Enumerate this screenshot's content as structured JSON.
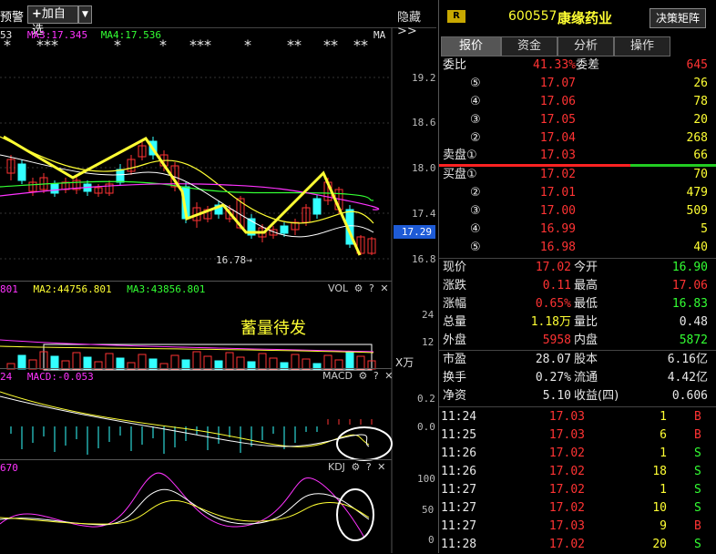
{
  "toolbar": {
    "warn_label": "预警",
    "add_watch_label": "加自选",
    "hide_label": "隐藏"
  },
  "kline": {
    "ma_labels": [
      "53",
      "MA3:17.345",
      "MA4:17.536"
    ],
    "ma_flag": "MA",
    "stars": [
      "*",
      "***",
      "*",
      "*",
      "***",
      "*",
      "**",
      "**",
      "**"
    ],
    "price_axis": [
      "19.2",
      "18.6",
      "18.0",
      "17.4",
      "16.8"
    ],
    "current_price_tag": "17.29",
    "low_label": "16.78"
  },
  "volume": {
    "ma_labels": [
      "801",
      "MA2:44756.801",
      "MA3:43856.801"
    ],
    "title": "VOL",
    "axis": [
      "24",
      "12"
    ],
    "unit": "X万",
    "annotation": "蓄量待发"
  },
  "macd": {
    "labels": [
      "24",
      "MACD:-0.053"
    ],
    "title": "MACD",
    "axis": [
      "0.2",
      "0.0"
    ]
  },
  "kdj": {
    "labels": [
      "670"
    ],
    "title": "KDJ",
    "axis": [
      "100",
      "50",
      "0"
    ]
  },
  "stock": {
    "badge": "R",
    "code": "600557",
    "name": "康缘药业",
    "decision_button": "决策矩阵"
  },
  "tabs": [
    "报价",
    "资金",
    "分析",
    "操作"
  ],
  "order_book": {
    "weibi_label": "委比",
    "weibi_value": "41.33%",
    "weicha_label": "委差",
    "weicha_value": "645",
    "asks": [
      {
        "level": "⑤",
        "price": "17.07",
        "vol": "26"
      },
      {
        "level": "④",
        "price": "17.06",
        "vol": "78"
      },
      {
        "level": "③",
        "price": "17.05",
        "vol": "20"
      },
      {
        "level": "②",
        "price": "17.04",
        "vol": "268"
      },
      {
        "level": "卖盘①",
        "price": "17.03",
        "vol": "66"
      }
    ],
    "bids": [
      {
        "level": "买盘①",
        "price": "17.02",
        "vol": "70"
      },
      {
        "level": "②",
        "price": "17.01",
        "vol": "479"
      },
      {
        "level": "③",
        "price": "17.00",
        "vol": "509"
      },
      {
        "level": "④",
        "price": "16.99",
        "vol": "5"
      },
      {
        "level": "⑤",
        "price": "16.98",
        "vol": "40"
      }
    ]
  },
  "quote": {
    "rows": [
      {
        "l1": "现价",
        "v1": "17.02",
        "l2": "今开",
        "v2": "16.90",
        "c1": "red",
        "c2": "green"
      },
      {
        "l1": "涨跌",
        "v1": "0.11",
        "l2": "最高",
        "v2": "17.06",
        "c1": "red",
        "c2": "red"
      },
      {
        "l1": "涨幅",
        "v1": "0.65%",
        "l2": "最低",
        "v2": "16.83",
        "c1": "red",
        "c2": "green"
      },
      {
        "l1": "总量",
        "v1": "1.18万",
        "l2": "量比",
        "v2": "0.48",
        "c1": "yellow",
        "c2": "white"
      },
      {
        "l1": "外盘",
        "v1": "5958",
        "l2": "内盘",
        "v2": "5872",
        "c1": "red",
        "c2": "green"
      }
    ],
    "fin_rows": [
      {
        "l1": "市盈",
        "v1": "28.07",
        "l2": "股本",
        "v2": "6.16亿"
      },
      {
        "l1": "换手",
        "v1": "0.27%",
        "l2": "流通",
        "v2": "4.42亿"
      },
      {
        "l1": "净资",
        "v1": "5.10",
        "l2": "收益(四)",
        "v2": "0.606"
      }
    ]
  },
  "ticks": [
    {
      "time": "11:24",
      "price": "17.03",
      "vol": "1",
      "side": "B"
    },
    {
      "time": "11:25",
      "price": "17.03",
      "vol": "6",
      "side": "B"
    },
    {
      "time": "11:26",
      "price": "17.02",
      "vol": "1",
      "side": "S"
    },
    {
      "time": "11:26",
      "price": "17.02",
      "vol": "18",
      "side": "S"
    },
    {
      "time": "11:27",
      "price": "17.02",
      "vol": "1",
      "side": "S"
    },
    {
      "time": "11:27",
      "price": "17.02",
      "vol": "10",
      "side": "S"
    },
    {
      "time": "11:27",
      "price": "17.03",
      "vol": "9",
      "side": "B"
    },
    {
      "time": "11:28",
      "price": "17.02",
      "vol": "20",
      "side": "S"
    }
  ],
  "colors": {
    "up": "#ff3333",
    "down": "#33ffff",
    "flat": "#33ff33",
    "ma_yellow": "#ffff33",
    "ma_magenta": "#ff33ff"
  }
}
